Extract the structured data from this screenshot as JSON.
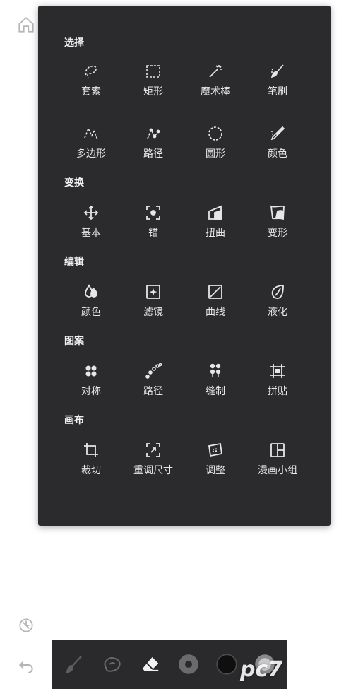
{
  "sections": [
    {
      "title": "选择",
      "tools": [
        {
          "label": "套索",
          "icon": "lasso-icon"
        },
        {
          "label": "矩形",
          "icon": "rect-select-icon"
        },
        {
          "label": "魔术棒",
          "icon": "magic-wand-icon"
        },
        {
          "label": "笔刷",
          "icon": "brush-select-icon"
        },
        {
          "label": "多边形",
          "icon": "polygon-icon"
        },
        {
          "label": "路径",
          "icon": "path-select-icon"
        },
        {
          "label": "圆形",
          "icon": "circle-select-icon"
        },
        {
          "label": "颜色",
          "icon": "color-picker-icon"
        }
      ]
    },
    {
      "title": "变换",
      "tools": [
        {
          "label": "基本",
          "icon": "move-icon"
        },
        {
          "label": "锚",
          "icon": "anchor-icon"
        },
        {
          "label": "扭曲",
          "icon": "distort-icon"
        },
        {
          "label": "变形",
          "icon": "warp-icon"
        }
      ]
    },
    {
      "title": "编辑",
      "tools": [
        {
          "label": "颜色",
          "icon": "drops-icon"
        },
        {
          "label": "滤镜",
          "icon": "filter-icon"
        },
        {
          "label": "曲线",
          "icon": "curves-icon"
        },
        {
          "label": "液化",
          "icon": "liquify-icon"
        }
      ]
    },
    {
      "title": "图案",
      "tools": [
        {
          "label": "对称",
          "icon": "symmetry-icon"
        },
        {
          "label": "路径",
          "icon": "pattern-path-icon"
        },
        {
          "label": "缝制",
          "icon": "stitch-icon"
        },
        {
          "label": "拼贴",
          "icon": "tile-icon"
        }
      ]
    },
    {
      "title": "画布",
      "tools": [
        {
          "label": "裁切",
          "icon": "crop-icon"
        },
        {
          "label": "重调尺寸",
          "icon": "resize-icon"
        },
        {
          "label": "调整",
          "icon": "adjust-canvas-icon"
        },
        {
          "label": "漫画小组",
          "icon": "comic-panel-icon"
        }
      ]
    }
  ],
  "watermark": "pc7"
}
